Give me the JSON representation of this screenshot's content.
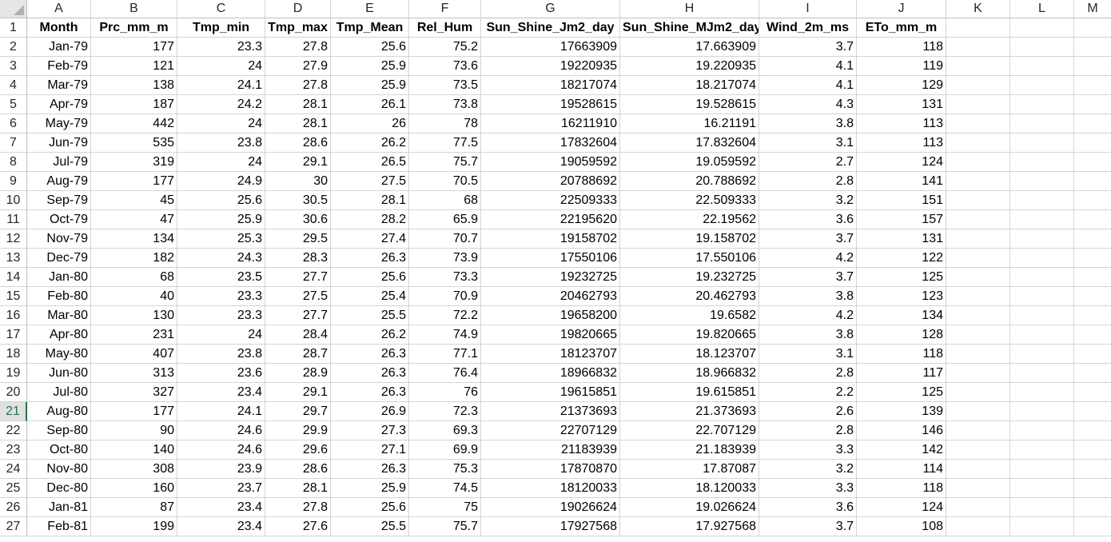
{
  "columns": [
    "A",
    "B",
    "C",
    "D",
    "E",
    "F",
    "G",
    "H",
    "I",
    "J",
    "K",
    "L",
    "M"
  ],
  "headers": [
    "Month",
    "Prc_mm_m",
    "Tmp_min",
    "Tmp_max",
    "Tmp_Mean",
    "Rel_Hum",
    "Sun_Shine_Jm2_day",
    "Sun_Shine_MJm2_day",
    "Wind_2m_ms",
    "ETo_mm_m"
  ],
  "selected_row": "21",
  "rows": [
    [
      "2",
      "Jan-79",
      "177",
      "23.3",
      "27.8",
      "25.6",
      "75.2",
      "17663909",
      "17.663909",
      "3.7",
      "118"
    ],
    [
      "3",
      "Feb-79",
      "121",
      "24",
      "27.9",
      "25.9",
      "73.6",
      "19220935",
      "19.220935",
      "4.1",
      "119"
    ],
    [
      "4",
      "Mar-79",
      "138",
      "24.1",
      "27.8",
      "25.9",
      "73.5",
      "18217074",
      "18.217074",
      "4.1",
      "129"
    ],
    [
      "5",
      "Apr-79",
      "187",
      "24.2",
      "28.1",
      "26.1",
      "73.8",
      "19528615",
      "19.528615",
      "4.3",
      "131"
    ],
    [
      "6",
      "May-79",
      "442",
      "24",
      "28.1",
      "26",
      "78",
      "16211910",
      "16.21191",
      "3.8",
      "113"
    ],
    [
      "7",
      "Jun-79",
      "535",
      "23.8",
      "28.6",
      "26.2",
      "77.5",
      "17832604",
      "17.832604",
      "3.1",
      "113"
    ],
    [
      "8",
      "Jul-79",
      "319",
      "24",
      "29.1",
      "26.5",
      "75.7",
      "19059592",
      "19.059592",
      "2.7",
      "124"
    ],
    [
      "9",
      "Aug-79",
      "177",
      "24.9",
      "30",
      "27.5",
      "70.5",
      "20788692",
      "20.788692",
      "2.8",
      "141"
    ],
    [
      "10",
      "Sep-79",
      "45",
      "25.6",
      "30.5",
      "28.1",
      "68",
      "22509333",
      "22.509333",
      "3.2",
      "151"
    ],
    [
      "11",
      "Oct-79",
      "47",
      "25.9",
      "30.6",
      "28.2",
      "65.9",
      "22195620",
      "22.19562",
      "3.6",
      "157"
    ],
    [
      "12",
      "Nov-79",
      "134",
      "25.3",
      "29.5",
      "27.4",
      "70.7",
      "19158702",
      "19.158702",
      "3.7",
      "131"
    ],
    [
      "13",
      "Dec-79",
      "182",
      "24.3",
      "28.3",
      "26.3",
      "73.9",
      "17550106",
      "17.550106",
      "4.2",
      "122"
    ],
    [
      "14",
      "Jan-80",
      "68",
      "23.5",
      "27.7",
      "25.6",
      "73.3",
      "19232725",
      "19.232725",
      "3.7",
      "125"
    ],
    [
      "15",
      "Feb-80",
      "40",
      "23.3",
      "27.5",
      "25.4",
      "70.9",
      "20462793",
      "20.462793",
      "3.8",
      "123"
    ],
    [
      "16",
      "Mar-80",
      "130",
      "23.3",
      "27.7",
      "25.5",
      "72.2",
      "19658200",
      "19.6582",
      "4.2",
      "134"
    ],
    [
      "17",
      "Apr-80",
      "231",
      "24",
      "28.4",
      "26.2",
      "74.9",
      "19820665",
      "19.820665",
      "3.8",
      "128"
    ],
    [
      "18",
      "May-80",
      "407",
      "23.8",
      "28.7",
      "26.3",
      "77.1",
      "18123707",
      "18.123707",
      "3.1",
      "118"
    ],
    [
      "19",
      "Jun-80",
      "313",
      "23.6",
      "28.9",
      "26.3",
      "76.4",
      "18966832",
      "18.966832",
      "2.8",
      "117"
    ],
    [
      "20",
      "Jul-80",
      "327",
      "23.4",
      "29.1",
      "26.3",
      "76",
      "19615851",
      "19.615851",
      "2.2",
      "125"
    ],
    [
      "21",
      "Aug-80",
      "177",
      "24.1",
      "29.7",
      "26.9",
      "72.3",
      "21373693",
      "21.373693",
      "2.6",
      "139"
    ],
    [
      "22",
      "Sep-80",
      "90",
      "24.6",
      "29.9",
      "27.3",
      "69.3",
      "22707129",
      "22.707129",
      "2.8",
      "146"
    ],
    [
      "23",
      "Oct-80",
      "140",
      "24.6",
      "29.6",
      "27.1",
      "69.9",
      "21183939",
      "21.183939",
      "3.3",
      "142"
    ],
    [
      "24",
      "Nov-80",
      "308",
      "23.9",
      "28.6",
      "26.3",
      "75.3",
      "17870870",
      "17.87087",
      "3.2",
      "114"
    ],
    [
      "25",
      "Dec-80",
      "160",
      "23.7",
      "28.1",
      "25.9",
      "74.5",
      "18120033",
      "18.120033",
      "3.3",
      "118"
    ],
    [
      "26",
      "Jan-81",
      "87",
      "23.4",
      "27.8",
      "25.6",
      "75",
      "19026624",
      "19.026624",
      "3.6",
      "124"
    ],
    [
      "27",
      "Feb-81",
      "199",
      "23.4",
      "27.6",
      "25.5",
      "75.7",
      "17927568",
      "17.927568",
      "3.7",
      "108"
    ]
  ]
}
